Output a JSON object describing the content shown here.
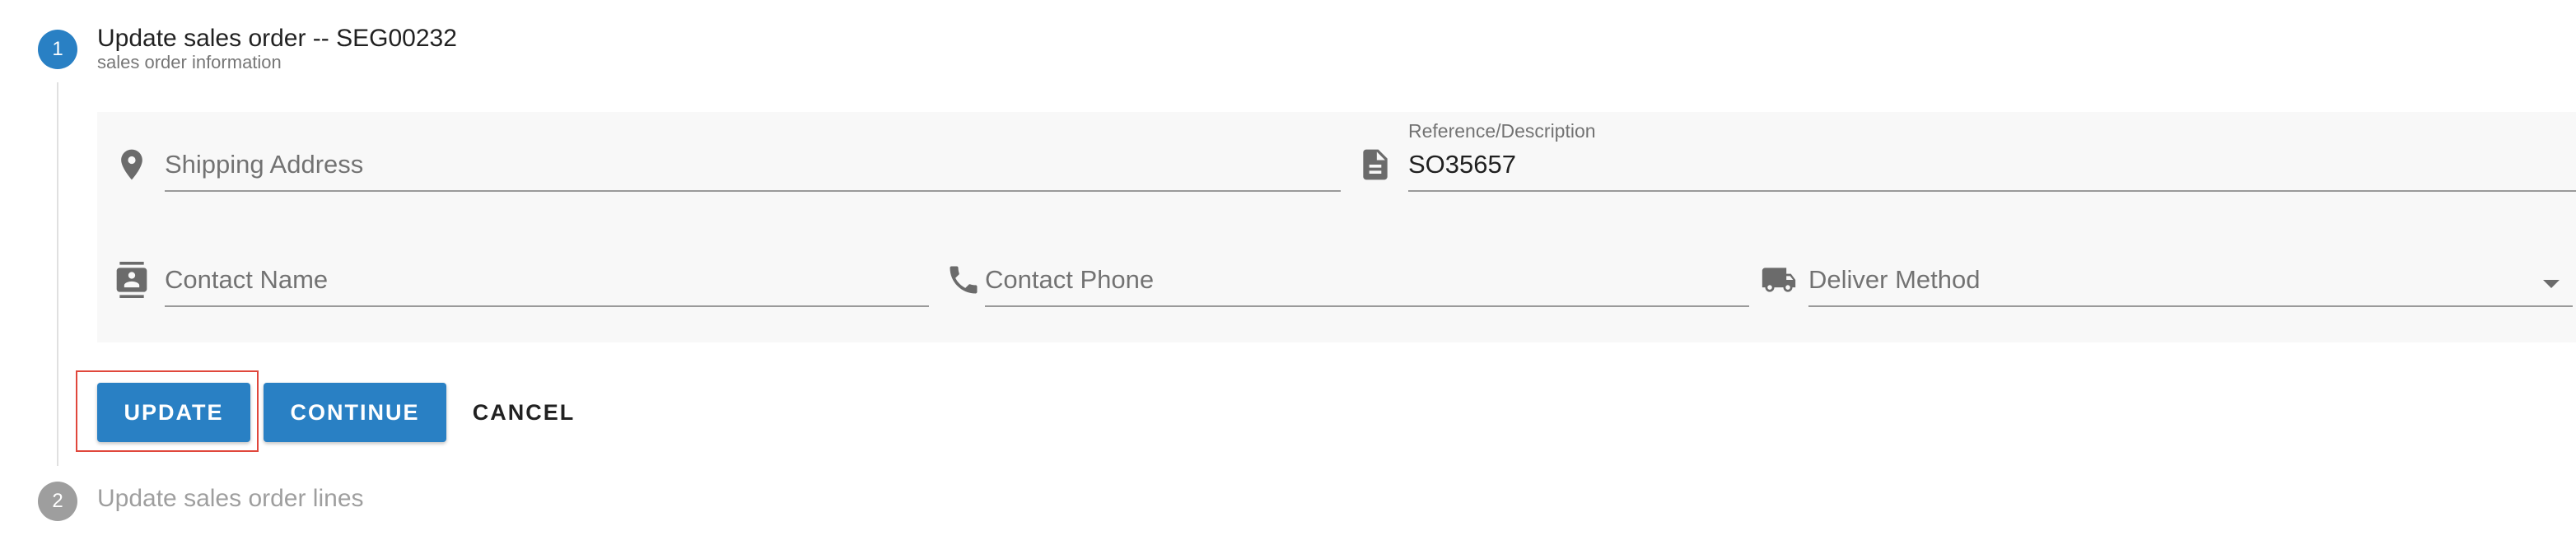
{
  "stepper": {
    "step1": {
      "number": "1",
      "title": "Update sales order -- SEG00232",
      "subtitle": "sales order information"
    },
    "step2": {
      "number": "2",
      "title": "Update sales order lines"
    }
  },
  "form": {
    "shipping_address": {
      "placeholder": "Shipping Address",
      "value": "",
      "icon": "location-pin-icon"
    },
    "reference": {
      "label": "Reference/Description",
      "value": "SO35657",
      "icon": "document-icon"
    },
    "contact_name": {
      "placeholder": "Contact Name",
      "value": "",
      "icon": "contact-card-icon"
    },
    "contact_phone": {
      "placeholder": "Contact Phone",
      "value": "",
      "icon": "phone-icon"
    },
    "deliver_method": {
      "placeholder": "Deliver Method",
      "selected": "",
      "icon": "truck-icon"
    }
  },
  "actions": {
    "update_label": "UPDATE",
    "continue_label": "CONTINUE",
    "cancel_label": "CANCEL"
  },
  "colors": {
    "primary": "#2980c4",
    "inactive_step": "#9e9e9e",
    "focus_outline": "#e0473c",
    "panel_background": "#f8f8f8"
  }
}
